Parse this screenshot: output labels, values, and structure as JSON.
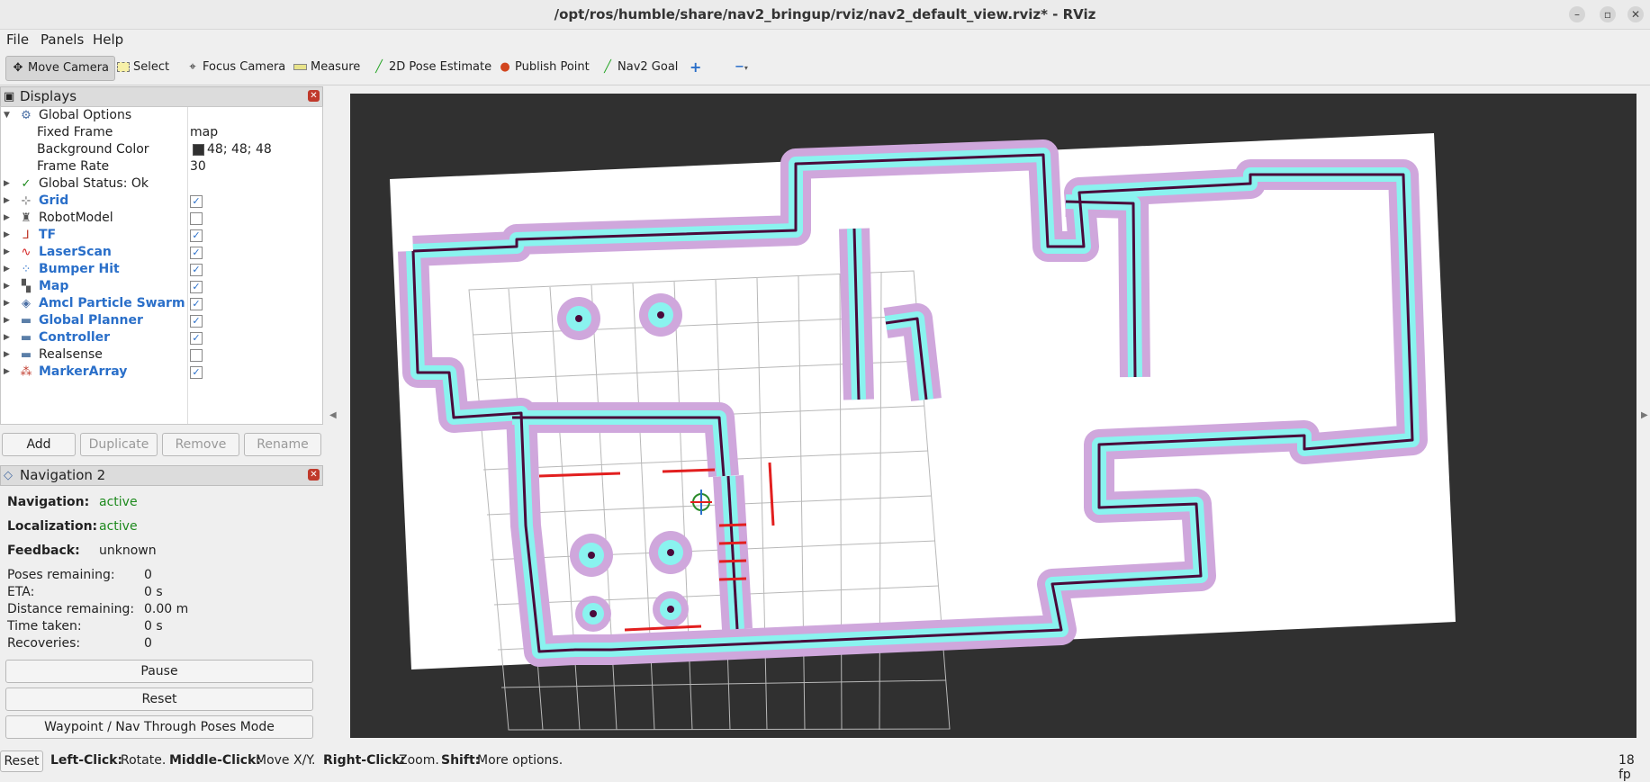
{
  "window": {
    "title": "/opt/ros/humble/share/nav2_bringup/rviz/nav2_default_view.rviz* - RViz"
  },
  "menubar": {
    "file": "File",
    "panels": "Panels",
    "help": "Help"
  },
  "toolbar": {
    "move_camera": "Move Camera",
    "select": "Select",
    "focus_camera": "Focus Camera",
    "measure": "Measure",
    "pose_estimate": "2D Pose Estimate",
    "publish_point": "Publish Point",
    "nav2_goal": "Nav2 Goal"
  },
  "displays": {
    "title": "Displays",
    "global_options": "Global Options",
    "fixed_frame_label": "Fixed Frame",
    "fixed_frame_value": "map",
    "bg_color_label": "Background Color",
    "bg_color_value": "48; 48; 48",
    "bg_color_swatch": "#303030",
    "frame_rate_label": "Frame Rate",
    "frame_rate_value": "30",
    "global_status": "Global Status: Ok",
    "items": [
      {
        "label": "Grid",
        "checked": true,
        "highlight": true
      },
      {
        "label": "RobotModel",
        "checked": false,
        "highlight": false
      },
      {
        "label": "TF",
        "checked": true,
        "highlight": true
      },
      {
        "label": "LaserScan",
        "checked": true,
        "highlight": true
      },
      {
        "label": "Bumper Hit",
        "checked": true,
        "highlight": true
      },
      {
        "label": "Map",
        "checked": true,
        "highlight": true
      },
      {
        "label": "Amcl Particle Swarm",
        "checked": true,
        "highlight": true
      },
      {
        "label": "Global Planner",
        "checked": true,
        "highlight": true
      },
      {
        "label": "Controller",
        "checked": true,
        "highlight": true
      },
      {
        "label": "Realsense",
        "checked": false,
        "highlight": false
      },
      {
        "label": "MarkerArray",
        "checked": true,
        "highlight": true
      }
    ],
    "buttons": {
      "add": "Add",
      "duplicate": "Duplicate",
      "remove": "Remove",
      "rename": "Rename"
    }
  },
  "navigation": {
    "title": "Navigation 2",
    "navigation_label": "Navigation:",
    "navigation_value": "active",
    "localization_label": "Localization:",
    "localization_value": "active",
    "feedback_label": "Feedback:",
    "feedback_value": "unknown",
    "poses_label": "Poses remaining:",
    "poses_value": "0",
    "eta_label": "ETA:",
    "eta_value": "0 s",
    "distance_label": "Distance remaining:",
    "distance_value": "0.00 m",
    "time_label": "Time taken:",
    "time_value": "0 s",
    "recoveries_label": "Recoveries:",
    "recoveries_value": "0",
    "pause": "Pause",
    "reset": "Reset",
    "waypoint_mode": "Waypoint / Nav Through Poses Mode"
  },
  "statusbar": {
    "reset": "Reset",
    "left_click": "Left-Click:",
    "left_click_desc": "Rotate.",
    "middle_click": "Middle-Click:",
    "middle_click_desc": "Move X/Y.",
    "right_click": "Right-Click:",
    "right_click_desc": "Zoom.",
    "shift": "Shift:",
    "shift_desc": "More options.",
    "fps": "18 fp"
  },
  "colors": {
    "accent_blue": "#2a6fc9",
    "active_green": "#1e8a1e",
    "inflation_purple": "#c9a0d8",
    "inflation_cyan": "#8af3ef",
    "wall": "#4a0a3a",
    "laser_red": "#e21f1f"
  }
}
